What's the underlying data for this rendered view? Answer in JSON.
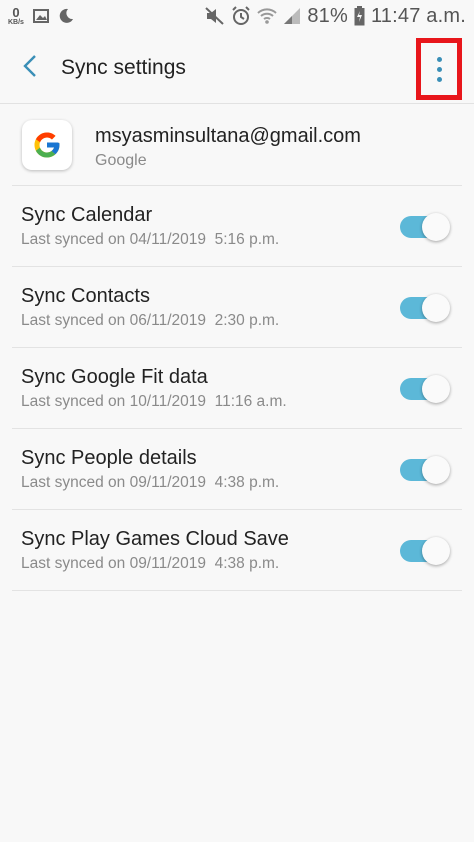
{
  "status_bar": {
    "data_speed_value": "0",
    "data_speed_unit": "KB/s",
    "battery": "81%",
    "time": "11:47 a.m.",
    "icons": [
      "image-icon",
      "moon-icon",
      "mute-icon",
      "alarm-icon",
      "wifi-icon",
      "signal-icon",
      "battery-icon"
    ]
  },
  "app_bar": {
    "title": "Sync settings",
    "back_icon": "chevron-left-icon",
    "menu_icon": "more-vert-icon"
  },
  "account": {
    "email": "msyasminsultana@gmail.com",
    "type": "Google"
  },
  "sync_items": [
    {
      "title": "Sync Calendar",
      "subtitle": "Last synced on 04/11/2019  5:16 p.m.",
      "enabled": true
    },
    {
      "title": "Sync Contacts",
      "subtitle": "Last synced on 06/11/2019  2:30 p.m.",
      "enabled": true
    },
    {
      "title": "Sync Google Fit data",
      "subtitle": "Last synced on 10/11/2019  11:16 a.m.",
      "enabled": true
    },
    {
      "title": "Sync People details",
      "subtitle": "Last synced on 09/11/2019  4:38 p.m.",
      "enabled": true
    },
    {
      "title": "Sync Play Games Cloud Save",
      "subtitle": "Last synced on 09/11/2019  4:38 p.m.",
      "enabled": true
    }
  ],
  "colors": {
    "accent": "#5cb8d8",
    "highlight_box": "#e8161b",
    "background": "#f8f8f8"
  }
}
